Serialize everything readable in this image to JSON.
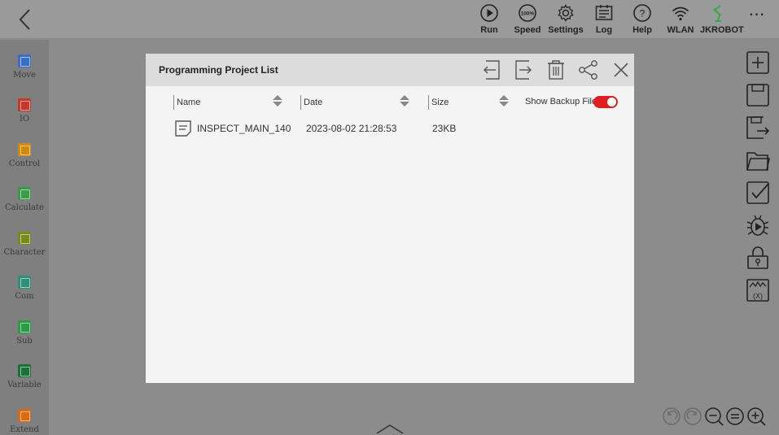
{
  "topbar": {
    "buttons": [
      {
        "label": "Run",
        "icon": "run-icon"
      },
      {
        "label": "Speed",
        "icon": "speed-icon"
      },
      {
        "label": "Settings",
        "icon": "settings-icon"
      },
      {
        "label": "Log",
        "icon": "log-icon"
      },
      {
        "label": "Help",
        "icon": "help-icon"
      },
      {
        "label": "WLAN",
        "icon": "wifi-icon"
      },
      {
        "label": "JKROBOT",
        "icon": "robot-arm-icon"
      }
    ],
    "speed_value": "100%",
    "more": "⋯"
  },
  "sidebar": {
    "items": [
      {
        "label": "Move",
        "color": "#3a6fc4"
      },
      {
        "label": "IO",
        "color": "#c0392b"
      },
      {
        "label": "Control",
        "color": "#d08a12"
      },
      {
        "label": "Calculate",
        "color": "#3c9a4a"
      },
      {
        "label": "Character",
        "color": "#7a8a1e"
      },
      {
        "label": "Com",
        "color": "#2f8f7a"
      },
      {
        "label": "Sub",
        "color": "#2e9a48"
      },
      {
        "label": "Variable",
        "color": "#1e6e3a"
      },
      {
        "label": "Extend",
        "color": "#d96a12"
      }
    ]
  },
  "dialog": {
    "title": "Programming Project List",
    "columns": [
      "Name",
      "Date",
      "Size"
    ],
    "backup_label": "Show Backup Files",
    "backup_on": true,
    "files": [
      {
        "name": "INSPECT_MAIN_140",
        "date": "2023-08-02 21:28:53",
        "size": "23KB"
      }
    ]
  },
  "colors": {
    "accent_red": "#e02020",
    "robot_green": "#3aa84a"
  }
}
